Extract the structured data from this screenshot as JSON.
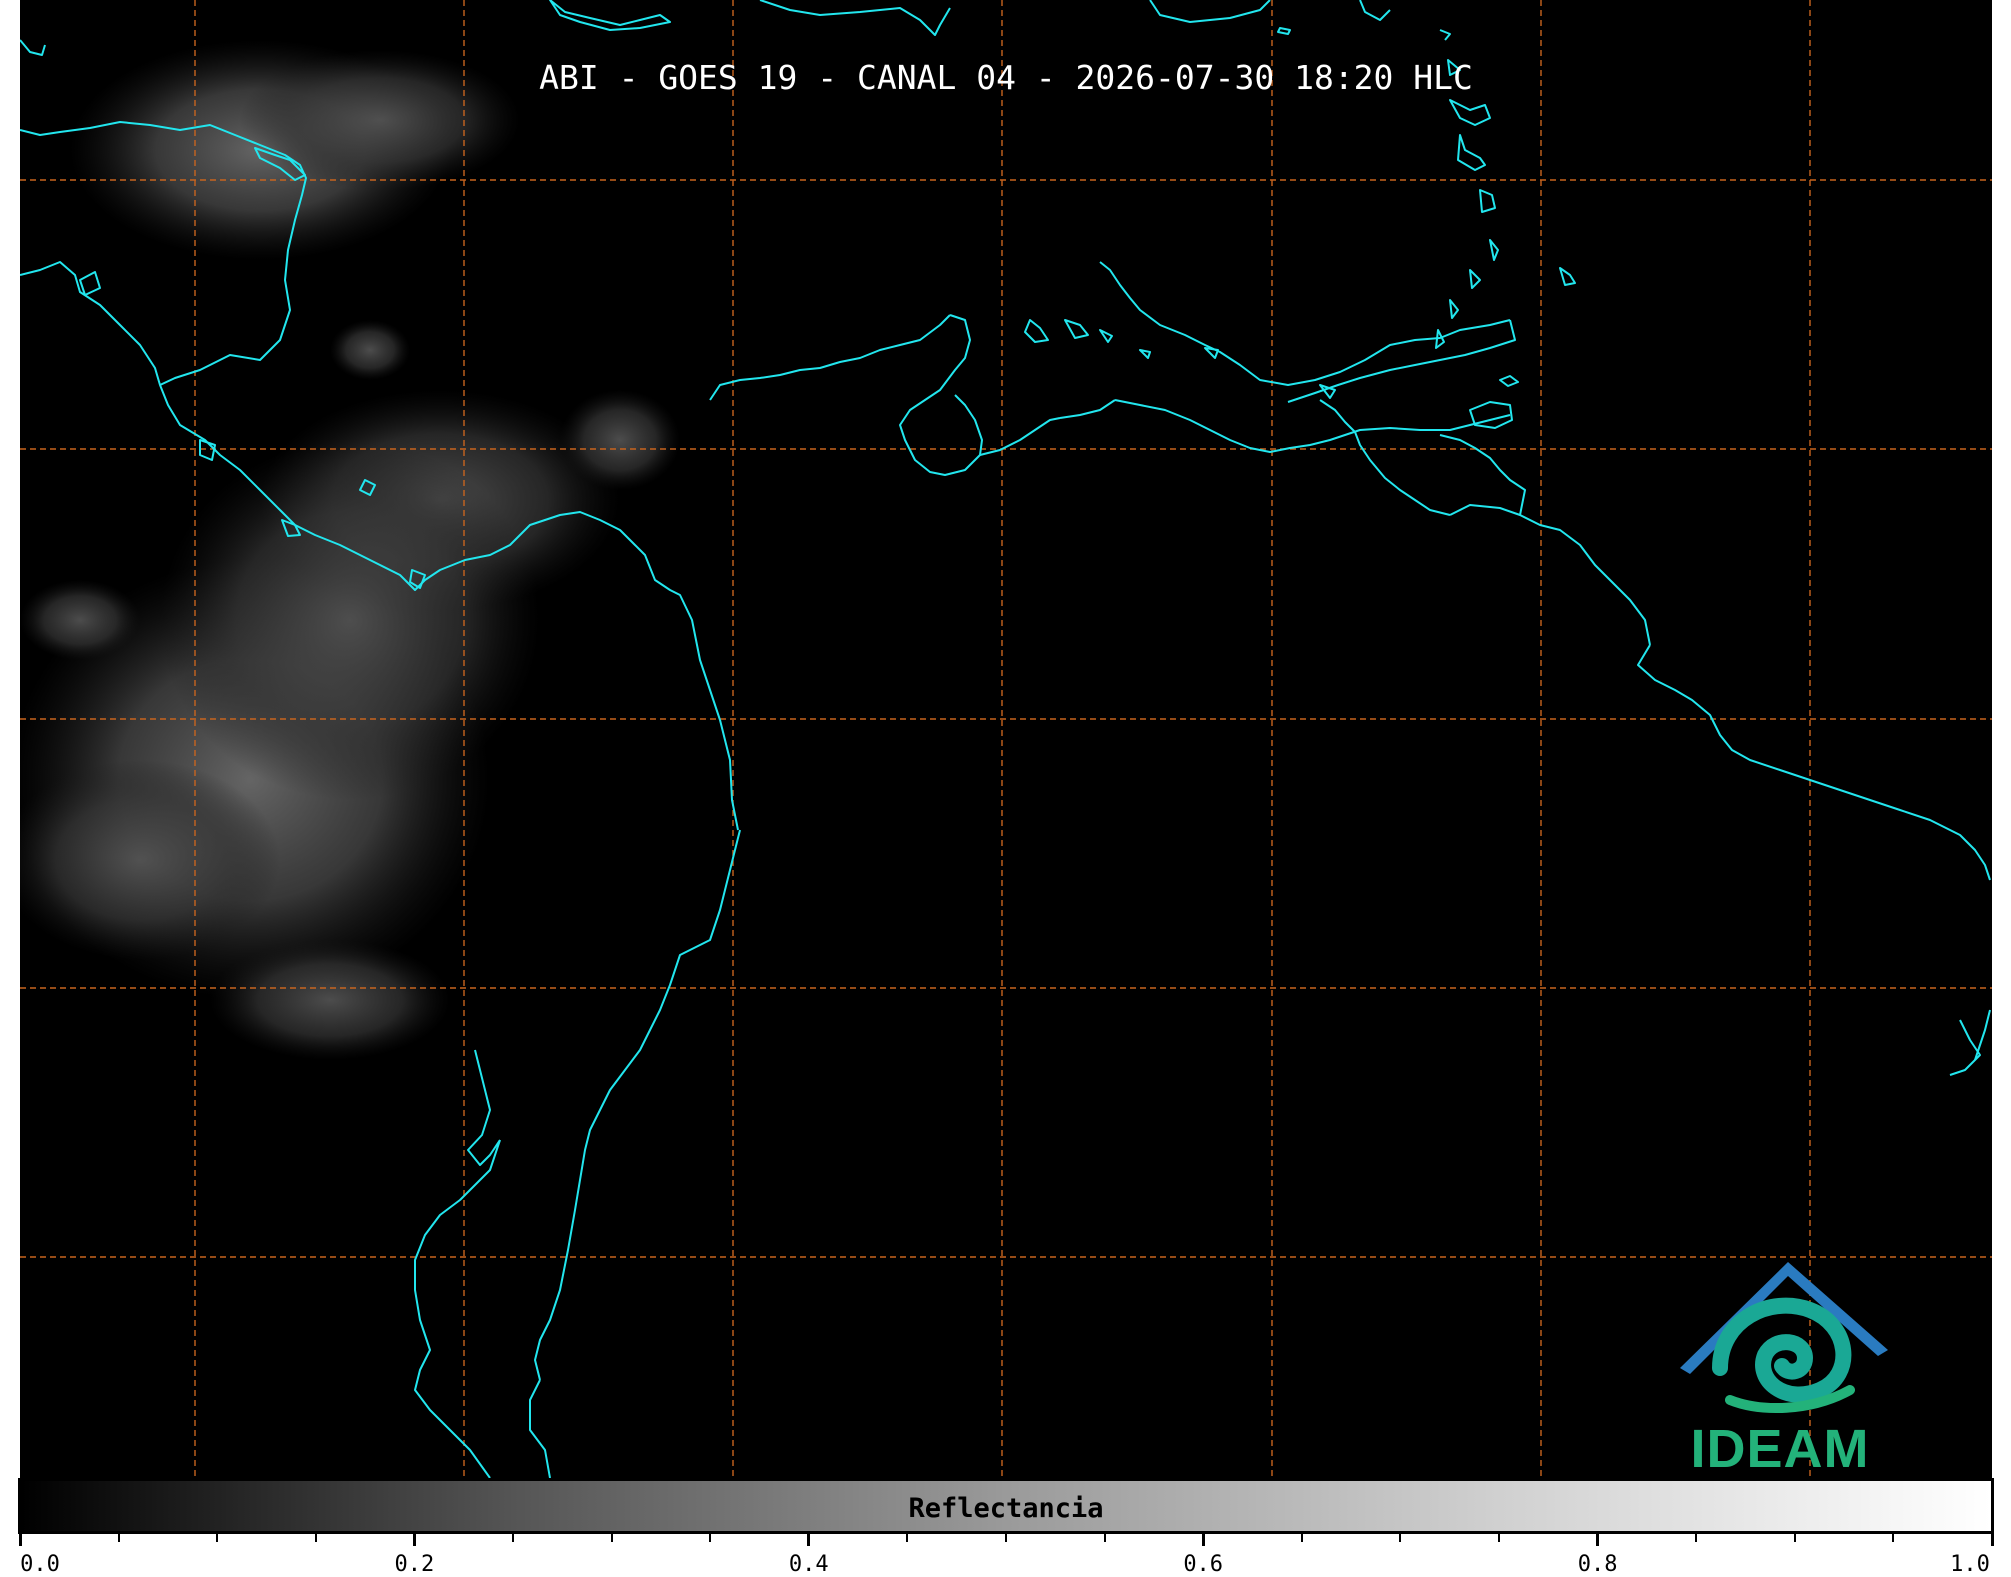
{
  "title": "ABI - GOES 19 - CANAL 04 - 2026-07-30 18:20 HLC",
  "colors": {
    "background": "#000000",
    "coastline": "#22e6ee",
    "gridline": "#c8641e",
    "title_text": "#ffffff",
    "logo_teal": "#1aa895",
    "logo_blue": "#2a7bc0",
    "logo_text": "#23b27a"
  },
  "map": {
    "gridlines": "dashed",
    "coastlines": "on",
    "cloud_regions": [
      "northwest",
      "west-central"
    ]
  },
  "colorbar": {
    "label": "Reflectancia",
    "ticks": [
      "0.0",
      "0.2",
      "0.4",
      "0.6",
      "0.8",
      "1.0"
    ],
    "range": [
      0.0,
      1.0
    ],
    "gradient": "black-to-white"
  },
  "logo": {
    "text": "IDEAM",
    "icon": "ideam-swirl-roof-icon"
  }
}
